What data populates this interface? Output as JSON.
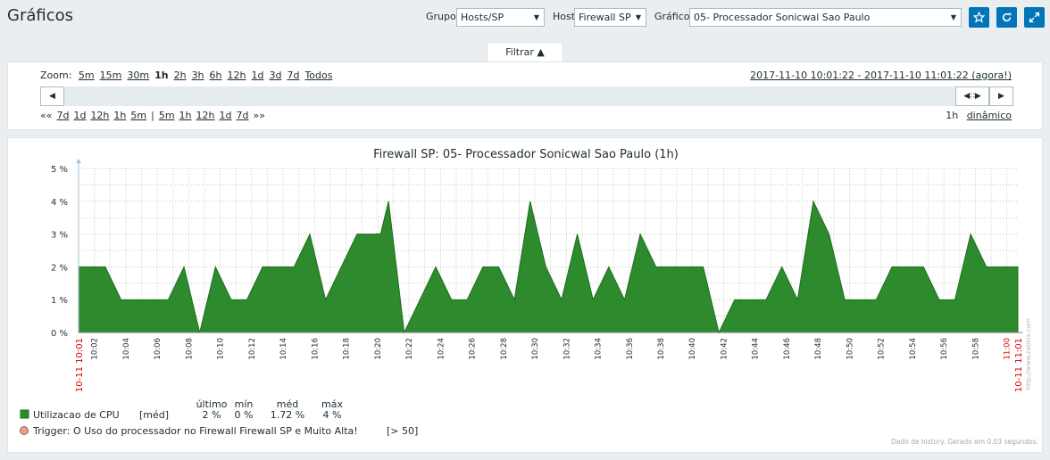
{
  "header": {
    "title": "Gráficos",
    "group_label": "Grupo",
    "group_value": "Hosts/SP",
    "host_label": "Host",
    "host_value": "Firewall SP",
    "graph_label": "Gráfico",
    "graph_value": "05- Processador Sonicwal Sao Paulo",
    "buttons": [
      "favorite-star-icon",
      "refresh-icon",
      "fullscreen-icon"
    ]
  },
  "filter": {
    "tab_label": "Filtrar ▲",
    "zoom_label": "Zoom:",
    "zoom_options": [
      "5m",
      "15m",
      "30m",
      "1h",
      "2h",
      "3h",
      "6h",
      "12h",
      "1d",
      "3d",
      "7d",
      "Todos"
    ],
    "zoom_active": "1h",
    "time_range": "2017-11-10 10:01:22 - 2017-11-10 11:01:22 (agora!)",
    "nav_back": [
      "««",
      "7d",
      "1d",
      "12h",
      "1h",
      "5m"
    ],
    "nav_sep": "|",
    "nav_fwd": [
      "5m",
      "1h",
      "12h",
      "1d",
      "7d",
      "»»"
    ],
    "period": "1h",
    "mode": "dinâmico"
  },
  "graph": {
    "title": "Firewall SP: 05- Processador Sonicwal Sao Paulo (1h)",
    "watermark": "http://www.zabbix.com",
    "footer_note": "Dado de history. Gerado em 0.03 segundos.",
    "legend": {
      "headers": [
        "último",
        "mín",
        "méd",
        "máx"
      ],
      "item_name": "Utilizacao de CPU",
      "item_func": "[méd]",
      "values": [
        "2 %",
        "0 %",
        "1.72 %",
        "4 %"
      ],
      "item_color": "#2d8a2d",
      "trigger_text": "Trigger: O Uso do processador no Firewall  Firewall SP e Muito Alta!",
      "trigger_cond": "[> 50]",
      "trigger_color": "#e8a090"
    }
  },
  "chart_data": {
    "type": "area",
    "title": "Firewall SP: 05- Processador Sonicwal Sao Paulo (1h)",
    "ylim": [
      0,
      5
    ],
    "y_ticks": [
      "0 %",
      "1 %",
      "2 %",
      "3 %",
      "4 %",
      "5 %"
    ],
    "x_start_label": "10-11 10:01",
    "x_end_label": "10-11 11:01",
    "x_tick_labels": [
      "10:02",
      "10:04",
      "10:06",
      "10:08",
      "10:10",
      "10:12",
      "10:14",
      "10:16",
      "10:18",
      "10:20",
      "10:22",
      "10:24",
      "10:26",
      "10:28",
      "10:30",
      "10:32",
      "10:34",
      "10:36",
      "10:38",
      "10:40",
      "10:42",
      "10:44",
      "10:46",
      "10:48",
      "10:50",
      "10:52",
      "10:54",
      "10:56",
      "10:58",
      "11:00"
    ],
    "series": [
      {
        "name": "Utilizacao de CPU",
        "color": "#2d8a2d",
        "x_minutes": [
          1,
          2.7,
          3.7,
          4.7,
          5.7,
          6.7,
          7.7,
          8.7,
          9.7,
          10.7,
          11.7,
          12.7,
          13.7,
          14.7,
          15.7,
          16.7,
          17.7,
          18.7,
          19.7,
          20.2,
          20.7,
          21.7,
          22.7,
          23.7,
          24.7,
          25.7,
          26.7,
          27.7,
          28.7,
          29.7,
          30.7,
          31.7,
          32.7,
          33.7,
          34.7,
          35.7,
          36.7,
          37.7,
          38.7,
          39.7,
          40.7,
          41.7,
          42.7,
          43.7,
          44.7,
          45.7,
          46.7,
          47.7,
          48.7,
          49.7,
          50.7,
          51.7,
          52.7,
          53.7,
          54.7,
          55.7,
          56.7,
          57.7,
          58.7,
          59.7,
          60.7
        ],
        "values": [
          2,
          2,
          1,
          1,
          1,
          1,
          2,
          0,
          2,
          1,
          1,
          2,
          2,
          2,
          3,
          1,
          2,
          3,
          3,
          3.01,
          4,
          0,
          1,
          2,
          1,
          1,
          2,
          2,
          1,
          4,
          2,
          1,
          3,
          1,
          2,
          1,
          3,
          2,
          2,
          2,
          2,
          0,
          1,
          1,
          1,
          2,
          1,
          4,
          3,
          1,
          1,
          1,
          2,
          2,
          2,
          1,
          1,
          3,
          2,
          2,
          2
        ]
      }
    ]
  }
}
